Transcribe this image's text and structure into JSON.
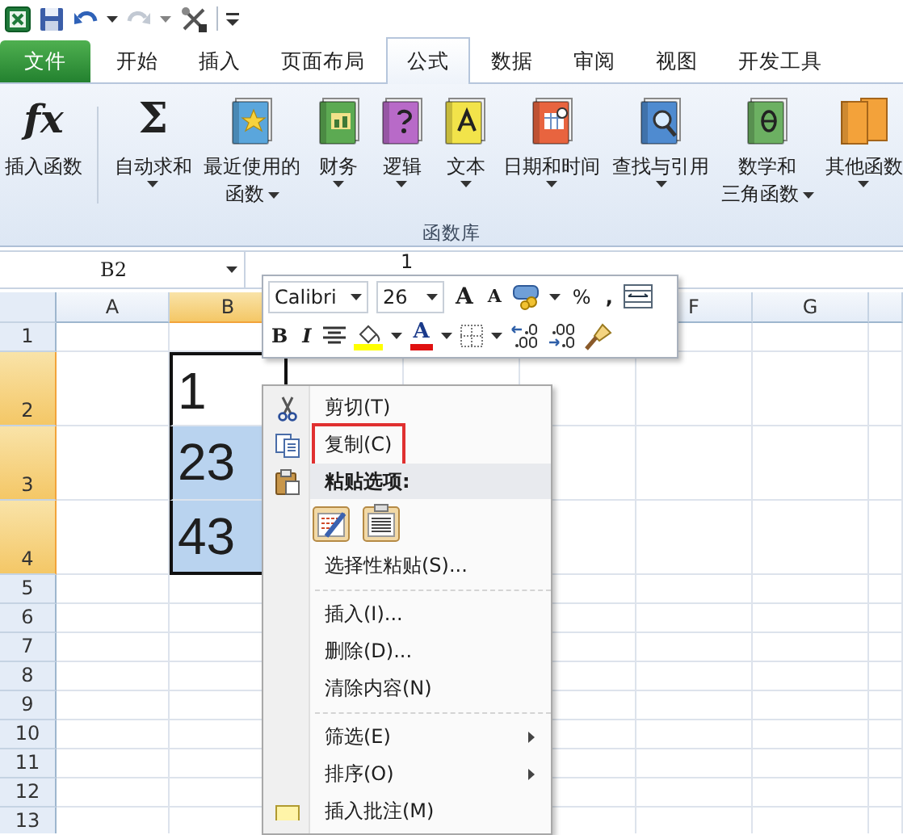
{
  "quick_access": [
    {
      "kind": "app",
      "disabled": false
    },
    {
      "kind": "save",
      "disabled": false
    },
    {
      "kind": "undo",
      "disabled": false
    },
    {
      "kind": "menu",
      "disabled": false
    },
    {
      "kind": "redo",
      "disabled": true
    },
    {
      "kind": "menu",
      "disabled": true
    },
    {
      "kind": "tools",
      "disabled": false
    },
    {
      "kind": "customize",
      "disabled": false
    }
  ],
  "tabs": [
    {
      "label": "文件",
      "kind": "file",
      "selected": false
    },
    {
      "label": "开始",
      "kind": "tab",
      "selected": false
    },
    {
      "label": "插入",
      "kind": "tab",
      "selected": false
    },
    {
      "label": "页面布局",
      "kind": "tab",
      "selected": false
    },
    {
      "label": "公式",
      "kind": "tab",
      "selected": true
    },
    {
      "label": "数据",
      "kind": "tab",
      "selected": false
    },
    {
      "label": "审阅",
      "kind": "tab",
      "selected": false
    },
    {
      "label": "视图",
      "kind": "tab",
      "selected": false
    },
    {
      "label": "开发工具",
      "kind": "tab",
      "selected": false
    }
  ],
  "ribbon": {
    "buttons": [
      {
        "kind": "insert-function",
        "glyph": "fx",
        "lines": [
          "插入函数"
        ],
        "dropdown": false
      },
      {
        "kind": "autosum",
        "glyph": "Σ",
        "lines": [
          "自动求和"
        ],
        "dropdown": true
      },
      {
        "kind": "recent",
        "lines": [
          "最近使用的",
          "函数"
        ],
        "dropdown": true
      },
      {
        "kind": "financial",
        "lines": [
          "财务"
        ],
        "dropdown": true
      },
      {
        "kind": "logical",
        "lines": [
          "逻辑"
        ],
        "dropdown": true
      },
      {
        "kind": "text",
        "lines": [
          "文本"
        ],
        "dropdown": true
      },
      {
        "kind": "datetime",
        "lines": [
          "日期和时间"
        ],
        "dropdown": true
      },
      {
        "kind": "lookup",
        "lines": [
          "查找与引用"
        ],
        "dropdown": true
      },
      {
        "kind": "math",
        "lines": [
          "数学和",
          "三角函数"
        ],
        "dropdown": true
      },
      {
        "kind": "more",
        "lines": [
          "其他函数"
        ],
        "dropdown": true
      }
    ],
    "group_label": "函数库"
  },
  "formula_bar": {
    "name_box": "B2",
    "value": "1"
  },
  "sheet": {
    "columns": [
      {
        "label": "A",
        "selected": false
      },
      {
        "label": "B",
        "selected": true
      },
      {
        "label": "F",
        "selected": false
      },
      {
        "label": "G",
        "selected": false
      }
    ],
    "rows": [
      {
        "label": "1",
        "selected": false
      },
      {
        "label": "2",
        "selected": true,
        "cell_b": {
          "value": "1",
          "selected": true,
          "active": true
        }
      },
      {
        "label": "3",
        "selected": true,
        "cell_b": {
          "value": "23",
          "selected": true,
          "active": false
        }
      },
      {
        "label": "4",
        "selected": true,
        "cell_b": {
          "value": "43",
          "selected": true,
          "active": false
        }
      },
      {
        "label": "5",
        "selected": false
      },
      {
        "label": "6",
        "selected": false
      },
      {
        "label": "7",
        "selected": false
      },
      {
        "label": "8",
        "selected": false
      },
      {
        "label": "9",
        "selected": false
      },
      {
        "label": "10",
        "selected": false
      },
      {
        "label": "11",
        "selected": false
      },
      {
        "label": "12",
        "selected": false
      },
      {
        "label": "13",
        "selected": false
      }
    ]
  },
  "mini_toolbar": {
    "font": "Calibri",
    "size": "26",
    "grow": "A",
    "shrink": "A",
    "percent": "%",
    "comma": ",",
    "bold": "B",
    "italic": "I",
    "font_color": "A"
  },
  "context_menu": {
    "items": [
      {
        "kind": "cut",
        "label": "剪切(T)",
        "marked": false
      },
      {
        "kind": "copy",
        "label": "复制(C)",
        "marked": true
      },
      {
        "kind": "header",
        "label": "粘贴选项:",
        "marked": false
      },
      {
        "kind": "paste-options"
      },
      {
        "kind": "command",
        "label": "选择性粘贴(S)...",
        "marked": false
      },
      {
        "kind": "separator"
      },
      {
        "kind": "command",
        "label": "插入(I)...",
        "marked": false
      },
      {
        "kind": "command",
        "label": "删除(D)...",
        "marked": false
      },
      {
        "kind": "command",
        "label": "清除内容(N)",
        "marked": false
      },
      {
        "kind": "separator"
      },
      {
        "kind": "submenu",
        "label": "筛选(E)",
        "marked": false
      },
      {
        "kind": "submenu",
        "label": "排序(O)",
        "marked": false
      },
      {
        "kind": "comment",
        "label": "插入批注(M)",
        "marked": false
      }
    ]
  }
}
